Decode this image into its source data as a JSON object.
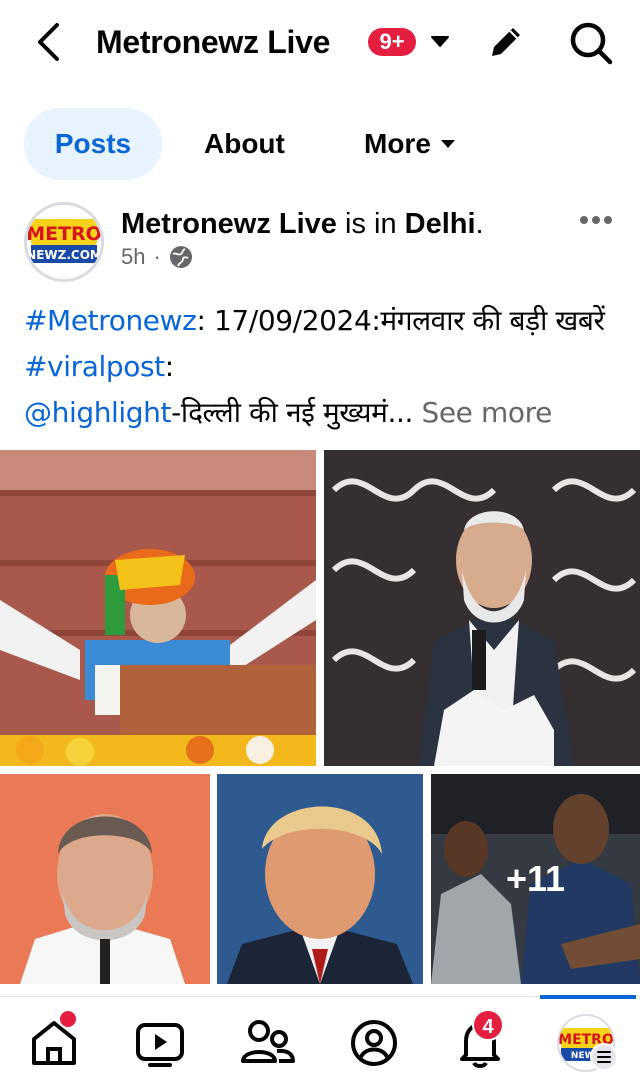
{
  "header": {
    "back_icon": "chevron-left-icon",
    "title": "Metronewz Live",
    "notification_badge": "9+",
    "caret_icon": "caret-down-icon",
    "edit_icon": "pencil-icon",
    "search_icon": "search-icon"
  },
  "tabs": [
    {
      "label": "Posts",
      "active": true
    },
    {
      "label": "About",
      "active": false
    },
    {
      "label": "More",
      "active": false
    }
  ],
  "post": {
    "avatar_logo_text": "METRO NEWZ.COM",
    "author": "Metronewz Live",
    "is_in": "is in",
    "location": "Delhi",
    "period": ".",
    "time": "5h",
    "separator": "·",
    "audience_icon": "globe-icon",
    "more_icon": "more-horizontal-icon",
    "text": {
      "tag1": "#Metronewz",
      "part1": ": 17/09/2024:मंगलवार की बड़ी खबरें ",
      "tag2": "#viralpost",
      "part2": ":",
      "tag3": "@highlight",
      "part3": "-दिल्ली की नई मुख्यमं...",
      "see_more": " See more"
    },
    "photos": [
      {
        "name": "photo-speech-red-fort"
      },
      {
        "name": "photo-speech-podium"
      },
      {
        "name": "photo-politician-portrait"
      },
      {
        "name": "photo-trump-portrait"
      },
      {
        "name": "photo-crowd",
        "more_count": "+11"
      }
    ]
  },
  "bottom_nav": {
    "items": [
      "home-icon",
      "video-icon",
      "friends-icon",
      "profile-icon",
      "notifications-icon",
      "page-avatar"
    ],
    "notifications_count": "4",
    "active": "page-avatar"
  },
  "colors": {
    "accent": "#0866d6",
    "badge_red": "#e41e3f",
    "tab_active_bg": "#e7f3ff",
    "secondary_text": "#65676b"
  }
}
